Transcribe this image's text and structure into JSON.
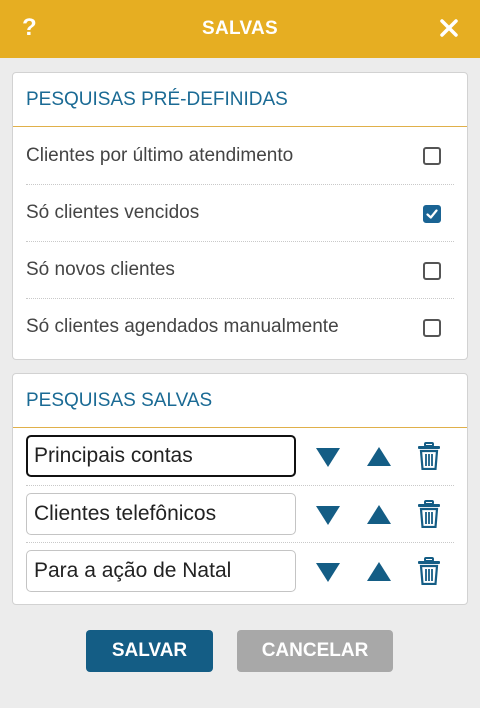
{
  "header": {
    "title": "SALVAS",
    "help": "?",
    "close_icon": "close-icon"
  },
  "predefined": {
    "title": "PESQUISAS PRÉ-DEFINIDAS",
    "items": [
      {
        "label": "Clientes por último atendimento",
        "checked": false
      },
      {
        "label": "Só clientes vencidos",
        "checked": true
      },
      {
        "label": "Só novos clientes",
        "checked": false
      },
      {
        "label": "Só clientes agendados manualmente",
        "checked": false
      }
    ]
  },
  "saved": {
    "title": "PESQUISAS SALVAS",
    "items": [
      {
        "value": "Principais contas"
      },
      {
        "value": "Clientes telefônicos"
      },
      {
        "value": "Para a ação de Natal"
      }
    ]
  },
  "buttons": {
    "save_label": "SALVAR",
    "cancel_label": "CANCELAR"
  },
  "colors": {
    "header": "#e6ae22",
    "accent": "#1a6a94",
    "save": "#145d85",
    "cancel": "#a8a8a8"
  }
}
